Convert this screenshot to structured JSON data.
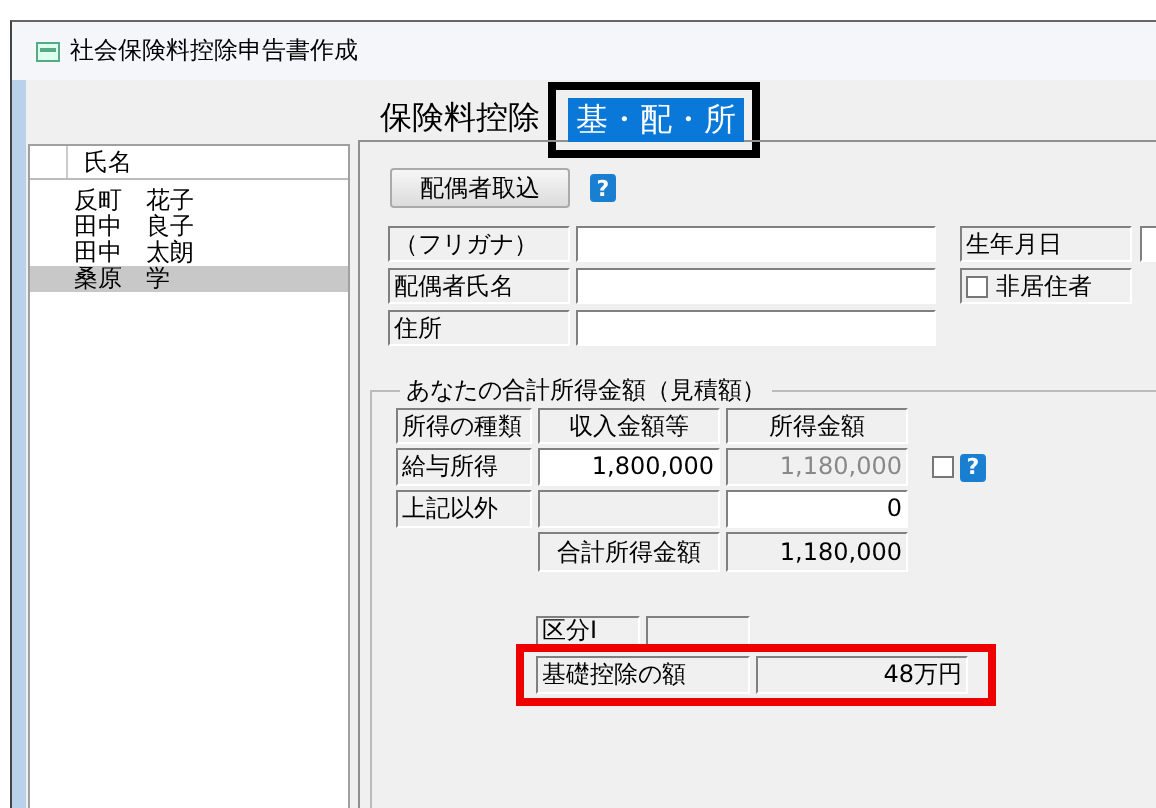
{
  "window": {
    "title": "社会保険料控除申告書作成"
  },
  "person_list": {
    "header": "氏名",
    "rows": [
      {
        "name": "反町　花子",
        "selected": false
      },
      {
        "name": "田中　良子",
        "selected": false
      },
      {
        "name": "田中　太朗",
        "selected": false
      },
      {
        "name": "桑原　学",
        "selected": true
      }
    ]
  },
  "tabs": [
    {
      "label": "保険料控除",
      "selected": false,
      "annotated": false
    },
    {
      "label": "基・配・所",
      "selected": true,
      "annotated": true
    }
  ],
  "spouse": {
    "import_button": "配偶者取込",
    "help": "?",
    "fields": [
      {
        "label": "（フリガナ）"
      },
      {
        "label": "配偶者氏名"
      },
      {
        "label": "住所"
      }
    ],
    "birth_date_label": "生年月日",
    "non_resident": {
      "label": "非居住者",
      "checked": false
    }
  },
  "income": {
    "title": "あなたの合計所得金額（見積額）",
    "columns": [
      "所得の種類",
      "収入金額等",
      "所得金額"
    ],
    "rows": [
      {
        "type": "給与所得",
        "revenue": {
          "value": "1,800,000",
          "disabled": false
        },
        "income": {
          "value": "1,180,000",
          "disabled": true
        },
        "checked": false,
        "help": "?"
      },
      {
        "type": "上記以外",
        "revenue": {
          "disabled": true
        },
        "income": {
          "value": "0",
          "disabled": false
        }
      }
    ],
    "total": {
      "label": "合計所得金額",
      "value": "1,180,000"
    },
    "category": {
      "label": "区分Ⅰ"
    },
    "basic_deduction": {
      "label": "基礎控除の額",
      "value": "48万円",
      "annotated": true
    }
  }
}
